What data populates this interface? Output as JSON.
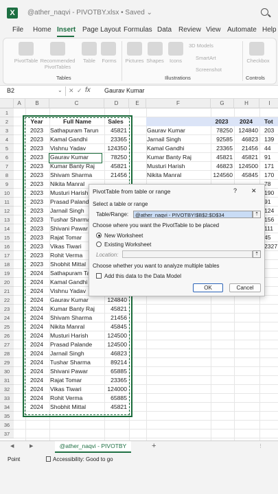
{
  "window": {
    "app_logo": "X",
    "title": "@ather_naqvi - PIVOTBY.xlsx • Saved ⌄",
    "search_icon": "magnifier"
  },
  "menu": {
    "items": [
      "File",
      "Home",
      "Insert",
      "Page Layout",
      "Formulas",
      "Data",
      "Review",
      "View",
      "Automate",
      "Help"
    ],
    "active": "Insert"
  },
  "ribbon": {
    "buttons": {
      "pivottable": "PivotTable",
      "recommended": "Recommended\nPivotTables",
      "table": "Table",
      "forms": "Forms",
      "pictures": "Pictures",
      "shapes": "Shapes",
      "icons": "Icons",
      "models3d": "3D Models",
      "smartart": "SmartArt",
      "screenshot": "Screenshot",
      "checkbox": "Checkbox"
    },
    "groups": {
      "tables": "Tables",
      "illustrations": "Illustrations",
      "controls": "Controls"
    }
  },
  "formula_bar": {
    "cell_ref": "B2",
    "fx": "fx",
    "value": "Gaurav Kumar"
  },
  "columns": [
    "A",
    "B",
    "C",
    "D",
    "E",
    "F",
    "G",
    "H",
    "I"
  ],
  "source_table": {
    "headers": {
      "year": "Year",
      "name": "Full Name",
      "sales": "Sales"
    },
    "rows": [
      {
        "year": "2023",
        "name": "Sathapuram Tarun",
        "sales": "45821"
      },
      {
        "year": "2023",
        "name": "Kamal Gandhi",
        "sales": "23365"
      },
      {
        "year": "2023",
        "name": "Vishnu Yadav",
        "sales": "124350"
      },
      {
        "year": "2023",
        "name": "Gaurav Kumar",
        "sales": "78250"
      },
      {
        "year": "2023",
        "name": "Kumar Banty Raj",
        "sales": "45821"
      },
      {
        "year": "2023",
        "name": "Shivam Sharma",
        "sales": "21456"
      },
      {
        "year": "2023",
        "name": "Nikita Manral",
        "sales": ""
      },
      {
        "year": "2023",
        "name": "Musturi Harish",
        "sales": ""
      },
      {
        "year": "2023",
        "name": "Prasad Palande",
        "sales": ""
      },
      {
        "year": "2023",
        "name": "Jarnail Singh",
        "sales": ""
      },
      {
        "year": "2023",
        "name": "Tushar Sharma",
        "sales": ""
      },
      {
        "year": "2023",
        "name": "Shivani Pawar",
        "sales": ""
      },
      {
        "year": "2023",
        "name": "Rajat Tomar",
        "sales": ""
      },
      {
        "year": "2023",
        "name": "Vikas Tiwari",
        "sales": ""
      },
      {
        "year": "2023",
        "name": "Rohit Verma",
        "sales": ""
      },
      {
        "year": "2023",
        "name": "Shobhit Mittal",
        "sales": ""
      },
      {
        "year": "2024",
        "name": "Sathapuram Tarun",
        "sales": ""
      },
      {
        "year": "2024",
        "name": "Kamal Gandhi",
        "sales": ""
      },
      {
        "year": "2024",
        "name": "Vishnu Yadav",
        "sales": ""
      },
      {
        "year": "2024",
        "name": "Gaurav Kumar",
        "sales": "124840"
      },
      {
        "year": "2024",
        "name": "Kumar Banty Raj",
        "sales": "45821"
      },
      {
        "year": "2024",
        "name": "Shivam Sharma",
        "sales": "21456"
      },
      {
        "year": "2024",
        "name": "Nikita Manral",
        "sales": "45845"
      },
      {
        "year": "2024",
        "name": "Musturi Harish",
        "sales": "124500"
      },
      {
        "year": "2024",
        "name": "Prasad Palande",
        "sales": "124500"
      },
      {
        "year": "2024",
        "name": "Jarnail Singh",
        "sales": "46823"
      },
      {
        "year": "2024",
        "name": "Tushar Sharma",
        "sales": "89214"
      },
      {
        "year": "2024",
        "name": "Shivani Pawar",
        "sales": "65885"
      },
      {
        "year": "2024",
        "name": "Rajat Tomar",
        "sales": "23365"
      },
      {
        "year": "2024",
        "name": "Vikas Tiwari",
        "sales": "124000"
      },
      {
        "year": "2024",
        "name": "Rohit Verma",
        "sales": "65885"
      },
      {
        "year": "2024",
        "name": "Shobhit Mittal",
        "sales": "45821"
      }
    ]
  },
  "pivot_table": {
    "headers": {
      "y2023": "2023",
      "y2024": "2024",
      "total": "Tot"
    },
    "rows": [
      {
        "name": "Gaurav Kumar",
        "y2023": "78250",
        "y2024": "124840",
        "total": "203"
      },
      {
        "name": "Jarnail Singh",
        "y2023": "92585",
        "y2024": "46823",
        "total": "139"
      },
      {
        "name": "Kamal Gandhi",
        "y2023": "23365",
        "y2024": "21456",
        "total": "44"
      },
      {
        "name": "Kumar Banty Raj",
        "y2023": "45821",
        "y2024": "45821",
        "total": "91"
      },
      {
        "name": "Musturi Harish",
        "y2023": "46823",
        "y2024": "124500",
        "total": "171"
      },
      {
        "name": "Nikita Manral",
        "y2023": "124560",
        "y2024": "45845",
        "total": "170"
      },
      {
        "name": "",
        "y2023": "",
        "y2024": "",
        "total": "78"
      },
      {
        "name": "",
        "y2023": "",
        "y2024": "",
        "total": "190"
      },
      {
        "name": "",
        "y2023": "",
        "y2024": "",
        "total": "91"
      },
      {
        "name": "",
        "y2023": "",
        "y2024": "",
        "total": "124"
      },
      {
        "name": "",
        "y2023": "",
        "y2024": "",
        "total": "156"
      },
      {
        "name": "",
        "y2023": "",
        "y2024": "",
        "total": "111"
      },
      {
        "name": "",
        "y2023": "",
        "y2024": "",
        "total": "45"
      },
      {
        "name": "",
        "y2023": "",
        "y2024": "",
        "total": "2327"
      }
    ]
  },
  "dialog": {
    "title": "PivotTable from table or range",
    "help": "?",
    "close": "✕",
    "section1": "Select a table or range",
    "range_label": "Table/Range:",
    "range_value": "@ather_naqvi - PIVOTBY!$B$2:$D$34",
    "section2": "Choose where you want the PivotTable to be placed",
    "opt_new": "New Worksheet",
    "opt_existing": "Existing Worksheet",
    "location_label": "Location:",
    "location_value": "",
    "section3": "Choose whether you want to analyze multiple tables",
    "datamodel_label": "Add this data to the Data Model",
    "ok": "OK",
    "cancel": "Cancel"
  },
  "sheet_tabs": {
    "prev": "◀",
    "next": "▶",
    "active": "@ather_naqvi - PIVOTBY",
    "add": "+"
  },
  "status": {
    "mode": "Point",
    "accessibility": "Accessibility: Good to go"
  },
  "colors": {
    "accent": "#1d6f42",
    "pivot_header": "#dbe4f7",
    "selection_border": "#1a6b3a"
  }
}
